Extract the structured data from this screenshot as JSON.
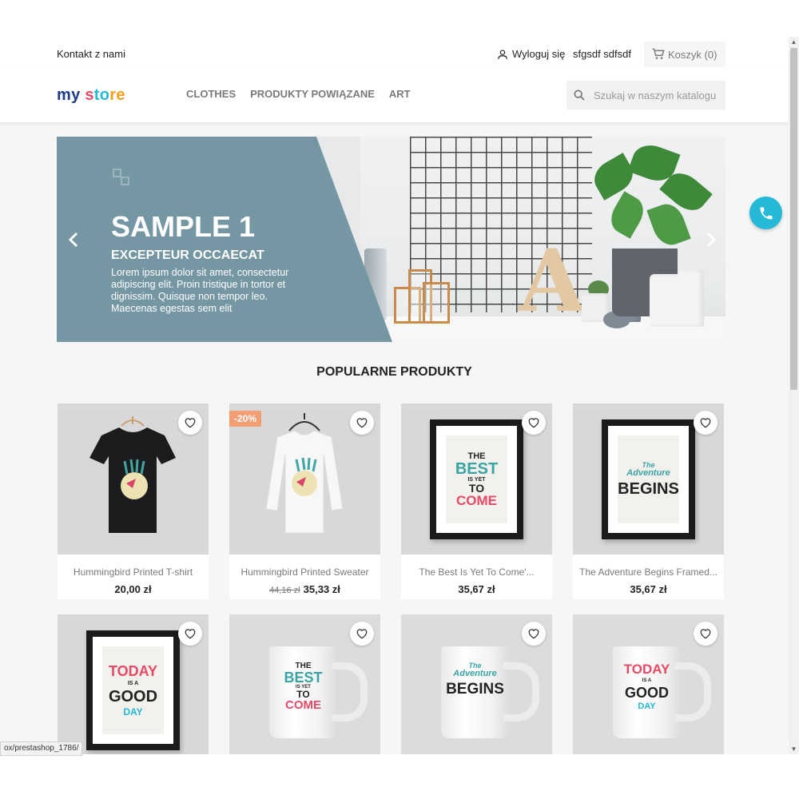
{
  "topbar": {
    "contact": "Kontakt z nami",
    "logout": "Wyloguj się",
    "user_name": "sfgsdf sdfsdf",
    "cart": "Koszyk (0)"
  },
  "header": {
    "logo": {
      "p1": "my",
      "p2": " s",
      "p3": "to",
      "p4": "re"
    },
    "nav": [
      "CLOTHES",
      "PRODUKTY POWIĄZANE",
      "ART"
    ],
    "search_placeholder": "Szukaj w naszym katalogu"
  },
  "slider": {
    "title": "SAMPLE 1",
    "subtitle": "EXCEPTEUR OCCAECAT",
    "text": "Lorem ipsum dolor sit amet, consectetur adipiscing elit. Proin tristique in tortor et dignissim. Quisque non tempor leo. Maecenas egestas sem elit",
    "prev_icon": "chevron-left-icon",
    "next_icon": "chevron-right-icon"
  },
  "section_title": "POPULARNE PRODUKTY",
  "products": [
    {
      "name": "Hummingbird Printed T-shirt",
      "price": "20,00 zł",
      "old_price": "",
      "badge": ""
    },
    {
      "name": "Hummingbird Printed Sweater",
      "price": "35,33 zł",
      "old_price": "44,16 zł",
      "badge": "-20%"
    },
    {
      "name": "The Best Is Yet To Come'...",
      "price": "35,67 zł",
      "old_price": "",
      "badge": ""
    },
    {
      "name": "The Adventure Begins Framed...",
      "price": "35,67 zł",
      "old_price": "",
      "badge": ""
    }
  ],
  "product_art": {
    "best": [
      "THE",
      "BEST",
      "IS YET",
      "TO",
      "COME"
    ],
    "adventure": [
      "The",
      "Adventure",
      "BEGINS"
    ],
    "today": [
      "TODAY",
      "IS A",
      "GOOD",
      "DAY"
    ]
  },
  "status_url": "ox/prestashop_1786/",
  "colors": {
    "accent": "#24b9d7",
    "slide_panel": "#7597a4",
    "badge": "#f39d72",
    "logo_blue": "#1f3c88",
    "logo_red": "#e64a64",
    "logo_cyan": "#24b9d7",
    "logo_orange": "#f39d21"
  }
}
